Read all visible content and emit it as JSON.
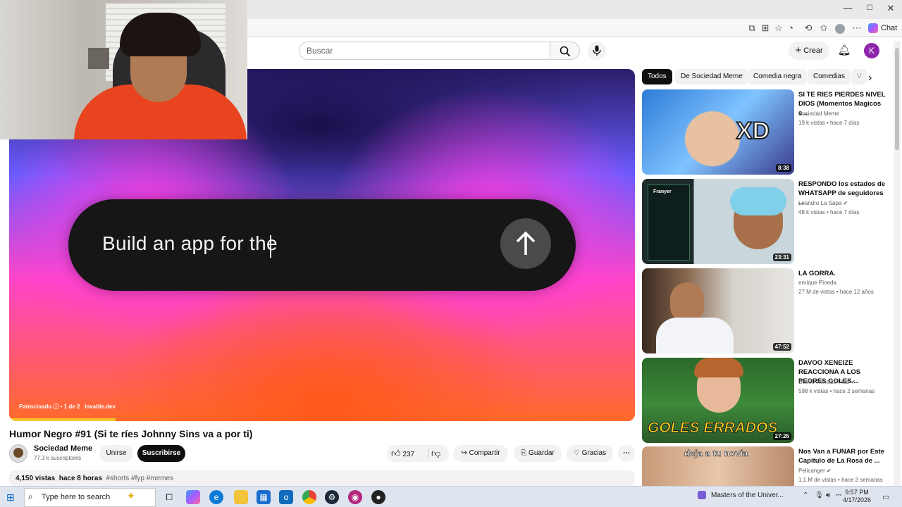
{
  "window": {
    "minimize": "—",
    "maximize": "☐",
    "close": "✕"
  },
  "toolbar": {
    "chat_label": "Chat"
  },
  "header": {
    "search_placeholder": "Buscar",
    "create_label": "Crear",
    "avatar_letter": "K"
  },
  "player": {
    "prompt_text": "Build an app for the",
    "ad_sponsored": "Patrocinado",
    "ad_count": "1 de 2",
    "ad_site": "lovable.dev",
    "progress": 0.17
  },
  "video": {
    "title": "Humor Negro #91 (Si te ríes Johnny Sins va a por ti)",
    "channel": "Sociedad Meme",
    "subscribers": "77.3 k suscriptores",
    "join_label": "Unirse",
    "subscribe_label": "Suscribirse",
    "likes": "237",
    "share_label": "Compartir",
    "save_label": "Guardar",
    "thanks_label": "Gracias",
    "views": "4,150 vistas",
    "age": "hace 8 horas",
    "tags": "#shorts #fyp #memes"
  },
  "chips": [
    "Todos",
    "De Sociedad Meme",
    "Comedia negra",
    "Comedias",
    "V"
  ],
  "recommendations": [
    {
      "title": "SI TE RIES PIERDES NIVEL DIOS (Momentos Magicos e...",
      "channel": "Sociedad Meme",
      "views": "19 k vistas",
      "age": "hace 7 días",
      "duration": "8:38",
      "thumb_text": "XD"
    },
    {
      "title": "RESPONDO los estados de WHATSAPP de seguidores ...",
      "channel": "Leandro La Sapa",
      "views": "48 k vistas",
      "age": "hace 7 días",
      "duration": "23:31",
      "thumb_text": "Franyer"
    },
    {
      "title": "LA GORRA.",
      "channel": "enrique Pineda",
      "views": "27 M de vistas",
      "age": "hace 12 años",
      "duration": "47:52",
      "thumb_text": ""
    },
    {
      "title": "DAVOO XENEIZE REACCIONA A LOS PEORES GOLES ...",
      "channel": "Davoo Xeneize Plus",
      "views": "598 k vistas",
      "age": "hace 2 semanas",
      "duration": "27:26",
      "thumb_text": "GOLES ERRADOS"
    },
    {
      "title": "Nos Van a FUNAR por Este Capitulo de La Rosa de ...",
      "channel": "Pelicanger",
      "views": "1.1 M de vistas",
      "age": "hace 3 semanas",
      "duration": "",
      "thumb_text": "deja a tu novia"
    }
  ],
  "taskbar": {
    "search_placeholder": "Type here to search",
    "media_title": "Masters of the Univer...",
    "time": "9:57 PM",
    "date": "4/17/2026"
  },
  "colors": {
    "subscribe": "#0f0f0f",
    "accent_yellow": "#f7c62f",
    "avatar": "#8e24aa"
  }
}
